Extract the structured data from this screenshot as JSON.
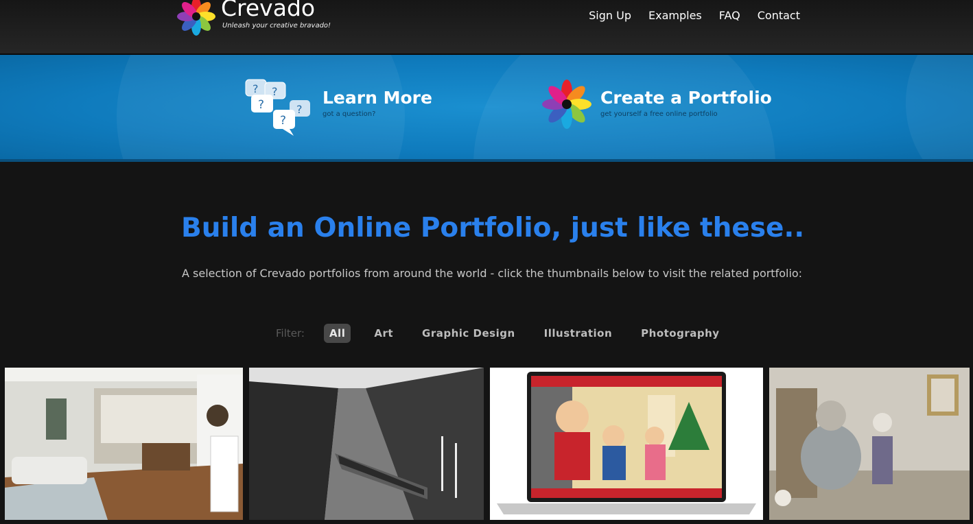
{
  "brand": {
    "name": "Crevado",
    "tagline": "Unleash your creative bravado!"
  },
  "nav": [
    {
      "label": "Sign Up"
    },
    {
      "label": "Examples"
    },
    {
      "label": "FAQ"
    },
    {
      "label": "Contact"
    }
  ],
  "banner": {
    "learn": {
      "title": "Learn More",
      "subtitle": "got a question?"
    },
    "create": {
      "title": "Create a Portfolio",
      "subtitle": "get yourself a free online portfolio"
    }
  },
  "main": {
    "title": "Build an Online Portfolio, just like these..",
    "description": "A selection of Crevado portfolios from around the world - click the thumbnails below to visit the related portfolio:"
  },
  "filter": {
    "label": "Filter:",
    "options": [
      {
        "label": "All",
        "active": true
      },
      {
        "label": "Art",
        "active": false
      },
      {
        "label": "Graphic Design",
        "active": false
      },
      {
        "label": "Illustration",
        "active": false
      },
      {
        "label": "Photography",
        "active": false
      }
    ]
  },
  "thumbnails": [
    {
      "icon": "living-room-photo"
    },
    {
      "icon": "river-boat-photo"
    },
    {
      "icon": "laptop-illustration"
    },
    {
      "icon": "sketch-illustration"
    }
  ],
  "colors": {
    "accent": "#2a80ec",
    "banner": "#1284c6",
    "header": "#1e1e1e"
  }
}
